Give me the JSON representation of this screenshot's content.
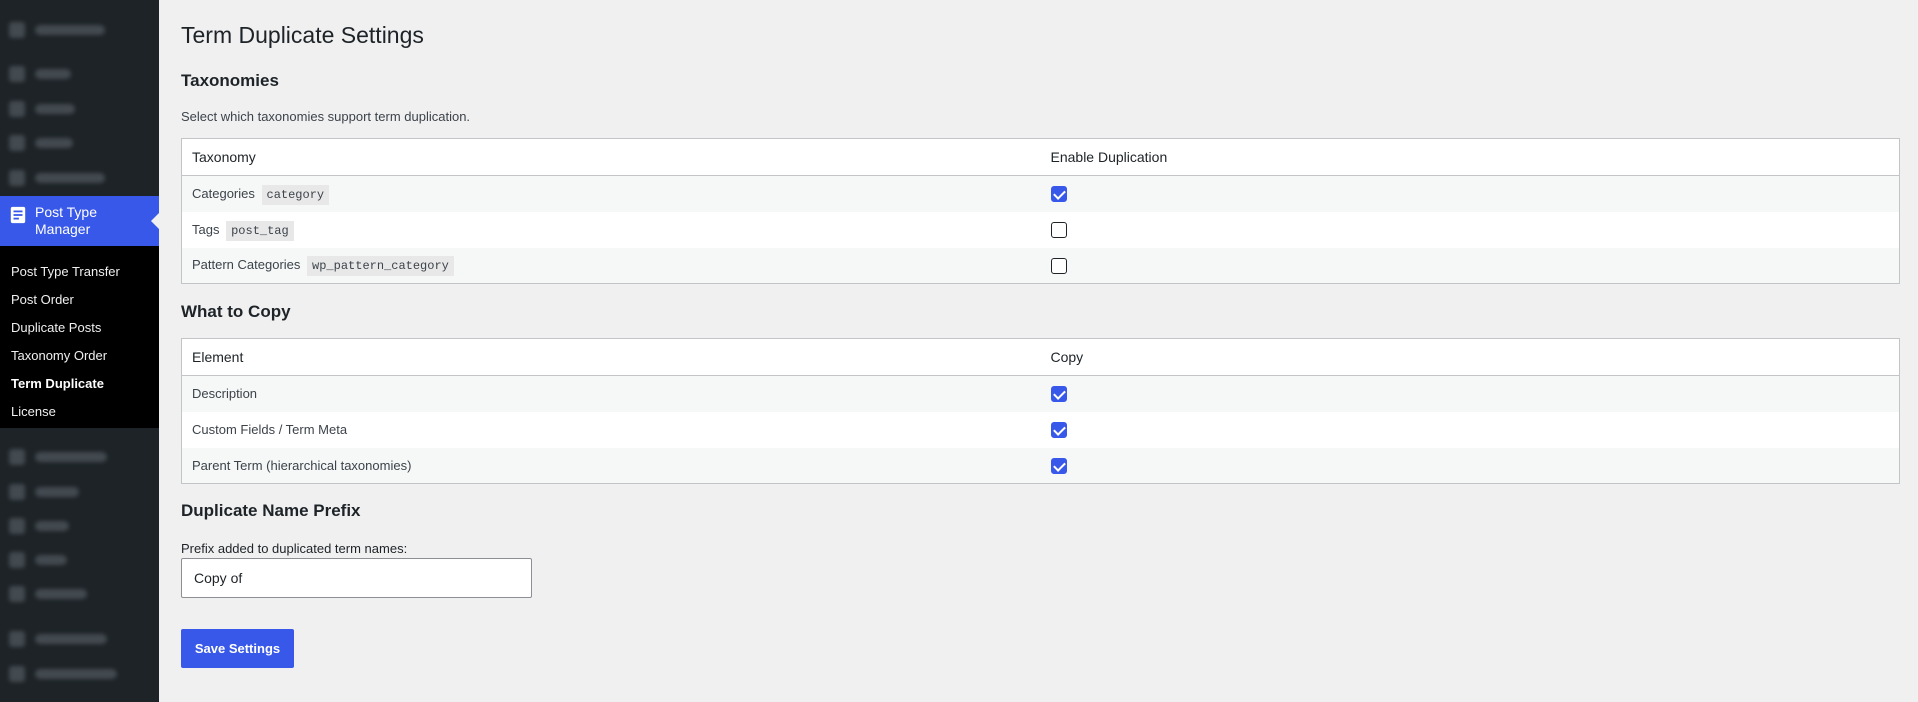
{
  "sidebar": {
    "active_menu": {
      "label": "Post Type Manager",
      "icon": "document-icon"
    },
    "submenu": [
      {
        "label": "Post Type Transfer",
        "current": false
      },
      {
        "label": "Post Order",
        "current": false
      },
      {
        "label": "Duplicate Posts",
        "current": false
      },
      {
        "label": "Taxonomy Order",
        "current": false
      },
      {
        "label": "Term Duplicate",
        "current": true
      },
      {
        "label": "License",
        "current": false
      }
    ]
  },
  "page": {
    "title": "Term Duplicate Settings"
  },
  "taxonomies": {
    "heading": "Taxonomies",
    "description": "Select which taxonomies support term duplication.",
    "columns": [
      "Taxonomy",
      "Enable Duplication"
    ],
    "rows": [
      {
        "label": "Categories",
        "slug": "category",
        "checked": true
      },
      {
        "label": "Tags",
        "slug": "post_tag",
        "checked": false
      },
      {
        "label": "Pattern Categories",
        "slug": "wp_pattern_category",
        "checked": false
      }
    ]
  },
  "what_to_copy": {
    "heading": "What to Copy",
    "columns": [
      "Element",
      "Copy"
    ],
    "rows": [
      {
        "label": "Description",
        "checked": true
      },
      {
        "label": "Custom Fields / Term Meta",
        "checked": true
      },
      {
        "label": "Parent Term (hierarchical taxonomies)",
        "checked": true
      }
    ]
  },
  "prefix": {
    "heading": "Duplicate Name Prefix",
    "field_label": "Prefix added to duplicated term names:",
    "value": "Copy of"
  },
  "save_label": "Save Settings",
  "colors": {
    "accent": "#3858e9",
    "sidebar_bg": "#1d2327",
    "submenu_bg": "#000000",
    "page_bg": "#f0f0f1"
  }
}
